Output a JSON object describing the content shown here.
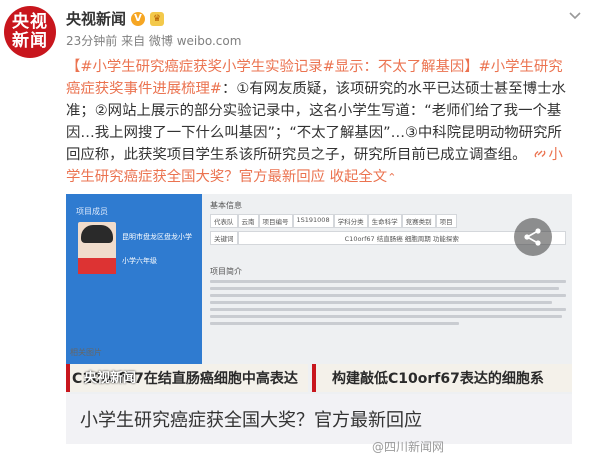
{
  "author": {
    "avatar_line1": "央视",
    "avatar_line2": "新闻",
    "name": "央视新闻",
    "verified_mark": "V",
    "medal_mark": "♛",
    "meta": "23分钟前 来自 微博 weibo.com"
  },
  "post": {
    "hashtag_1": "【#小学生研究癌症获奖小学生实验记录#显示：不太了解基因】",
    "hashtag_2": "#小学生研究癌症获奖事件进展梳理#",
    "body_1": "：①有网友质疑，该项研究的水平已达硕士甚至博士水准；②网站上展示的部分实验记录中，这名小学生写道：“老师们给了我一个基因…我上网搜了一下什么叫基因”；“不太了解基因”…③中科院昆明动物研究所回应称，此获奖项目学生系该所研究员之子，研究所目前已成立调查组。",
    "link_1": "小学生研究癌症获全国大奖？官方最新回应",
    "link_2": "收起全文",
    "link_2_arrow": "⌃"
  },
  "card": {
    "profile_title": "项目成员",
    "profile_school": "昆明市盘龙区盘龙小学",
    "profile_grade": "小学六年级",
    "section_basic": "基本信息",
    "row1": [
      "代表队",
      "云南",
      "项目编号",
      "1S191008",
      "学科分类",
      "生命科学",
      "竞赛类别",
      "项目"
    ],
    "row2": [
      "关键词",
      "C10orf67 结直肠癌 细胞周期 功能探索"
    ],
    "section_summary": "项目简介",
    "related": "相关图片",
    "fig_left": "C10orf67在结直肠癌细胞中高表达",
    "fig_right": "构建敲低C10orf67表达的细胞系",
    "overlay_wm": "央视新闻",
    "title": "小学生研究癌症获全国大奖？官方最新回应",
    "watermark": "@四川新闻网"
  },
  "colors": {
    "brand_red": "#c8161d",
    "link_orange": "#eb7350",
    "profile_blue": "#2f7bd0"
  },
  "icons": [
    "chevron-down-icon",
    "share-icon",
    "link-icon",
    "verified-icon",
    "medal-icon"
  ]
}
